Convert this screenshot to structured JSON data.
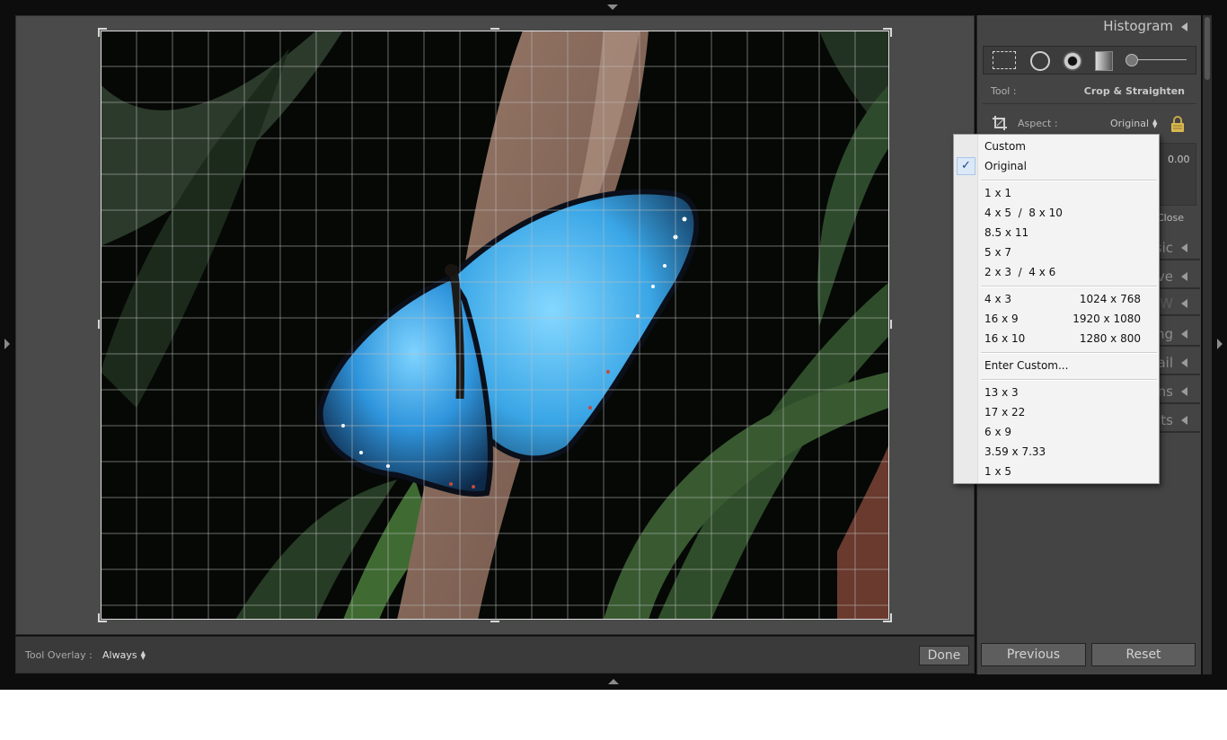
{
  "toolbar": {
    "overlay_label": "Tool Overlay :",
    "overlay_value": "Always",
    "done_label": "Done"
  },
  "right_panel": {
    "histogram_title": "Histogram",
    "tool_label": "Tool :",
    "tool_value": "Crop & Straighten",
    "aspect_label": "Aspect :",
    "aspect_value": "Original",
    "angle_value": "0.00",
    "close_label": "Close",
    "sections": [
      {
        "title": "sic"
      },
      {
        "title": "ve"
      },
      {
        "title": "W"
      },
      {
        "title": "ng"
      },
      {
        "title": "ail"
      },
      {
        "title": "ns"
      },
      {
        "title": "cts"
      }
    ],
    "previous_label": "Previous",
    "reset_label": "Reset"
  },
  "aspect_menu": {
    "check_mark": "✓",
    "items": [
      {
        "label": "Custom",
        "resolution": ""
      },
      {
        "label": "Original",
        "resolution": "",
        "checked": true
      },
      {
        "label": "1 x 1",
        "resolution": ""
      },
      {
        "label": "4 x 5  /  8 x 10",
        "resolution": ""
      },
      {
        "label": "8.5 x 11",
        "resolution": ""
      },
      {
        "label": "5 x 7",
        "resolution": ""
      },
      {
        "label": "2 x 3  /  4 x 6",
        "resolution": ""
      },
      {
        "label": "4 x 3",
        "resolution": "1024 x 768"
      },
      {
        "label": "16 x 9",
        "resolution": "1920 x 1080"
      },
      {
        "label": "16 x 10",
        "resolution": "1280 x 800"
      },
      {
        "label": "Enter Custom...",
        "resolution": ""
      },
      {
        "label": "13 x 3",
        "resolution": ""
      },
      {
        "label": "17 x 22",
        "resolution": ""
      },
      {
        "label": "6 x 9",
        "resolution": ""
      },
      {
        "label": "3.59 x 7.33",
        "resolution": ""
      },
      {
        "label": "1 x 5",
        "resolution": ""
      }
    ]
  },
  "icons": {
    "panel_toggle": "triangle",
    "crop_tool": "crop-marquee-icon",
    "spot_removal": "spot-removal-icon",
    "red_eye": "red-eye-icon",
    "graduated_filter": "graduated-filter-icon",
    "adjustment_brush": "adjustment-brush-icon",
    "crop_overlay": "crop-overlay-icon",
    "lock": "lock-icon"
  },
  "colors": {
    "background": "#0d0d0d",
    "panel": "#444444",
    "butterfly_blue": "#3fa9e8",
    "menu_background": "#f3f3f3"
  }
}
